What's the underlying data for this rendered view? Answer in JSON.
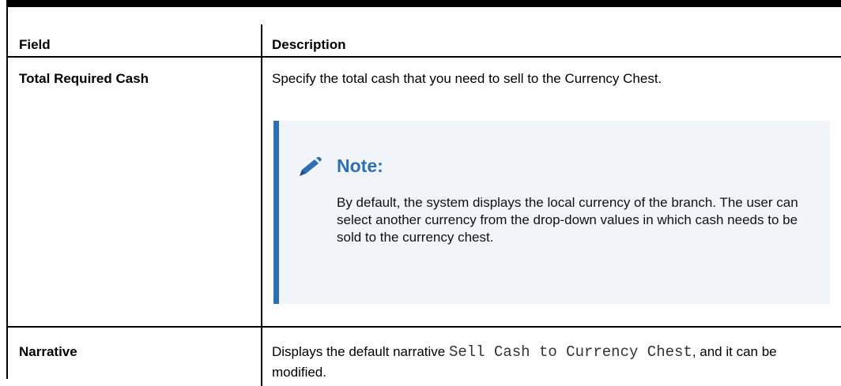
{
  "table": {
    "header": {
      "field": "Field",
      "description": "Description"
    },
    "rows": [
      {
        "field": "Total Required Cash",
        "description": "Specify the total cash that you need to sell to the Currency Chest.",
        "note": {
          "icon": "pencil-icon",
          "title": "Note:",
          "text": "By default, the system displays the local currency of the branch. The user can select another currency from the drop-down values in which cash needs to be sold to the currency chest."
        }
      },
      {
        "field": "Narrative",
        "description_prefix": "Displays the default narrative ",
        "description_code": "Sell Cash to Currency Chest",
        "description_suffix": ", and it can be modified."
      }
    ]
  },
  "colors": {
    "note_accent": "#2e6fb3",
    "note_background": "#f1f5fa",
    "border": "#000000"
  }
}
